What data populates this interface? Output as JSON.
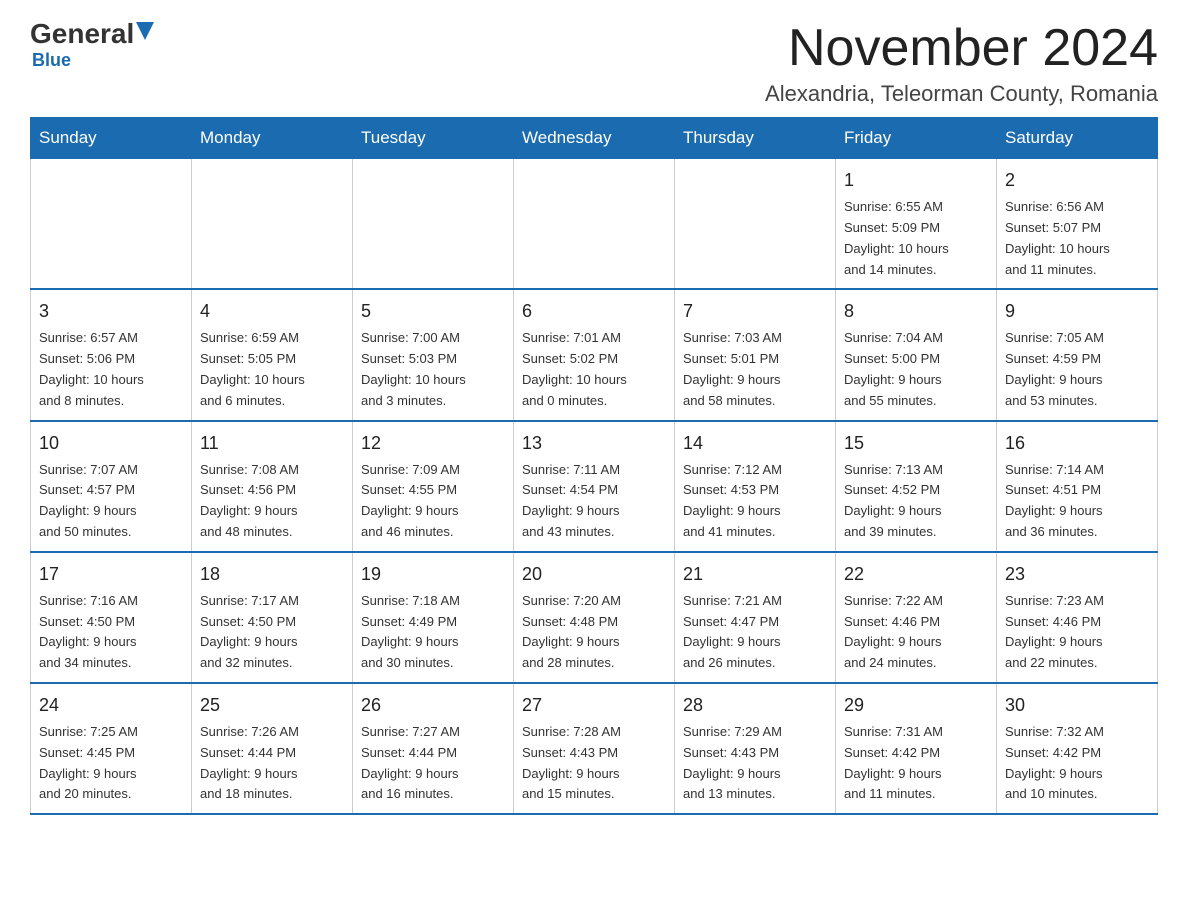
{
  "logo": {
    "general": "General",
    "triangle_symbol": "▶",
    "blue": "Blue"
  },
  "header": {
    "month": "November 2024",
    "location": "Alexandria, Teleorman County, Romania"
  },
  "days_of_week": [
    "Sunday",
    "Monday",
    "Tuesday",
    "Wednesday",
    "Thursday",
    "Friday",
    "Saturday"
  ],
  "weeks": [
    [
      {
        "day": "",
        "info": ""
      },
      {
        "day": "",
        "info": ""
      },
      {
        "day": "",
        "info": ""
      },
      {
        "day": "",
        "info": ""
      },
      {
        "day": "",
        "info": ""
      },
      {
        "day": "1",
        "info": "Sunrise: 6:55 AM\nSunset: 5:09 PM\nDaylight: 10 hours\nand 14 minutes."
      },
      {
        "day": "2",
        "info": "Sunrise: 6:56 AM\nSunset: 5:07 PM\nDaylight: 10 hours\nand 11 minutes."
      }
    ],
    [
      {
        "day": "3",
        "info": "Sunrise: 6:57 AM\nSunset: 5:06 PM\nDaylight: 10 hours\nand 8 minutes."
      },
      {
        "day": "4",
        "info": "Sunrise: 6:59 AM\nSunset: 5:05 PM\nDaylight: 10 hours\nand 6 minutes."
      },
      {
        "day": "5",
        "info": "Sunrise: 7:00 AM\nSunset: 5:03 PM\nDaylight: 10 hours\nand 3 minutes."
      },
      {
        "day": "6",
        "info": "Sunrise: 7:01 AM\nSunset: 5:02 PM\nDaylight: 10 hours\nand 0 minutes."
      },
      {
        "day": "7",
        "info": "Sunrise: 7:03 AM\nSunset: 5:01 PM\nDaylight: 9 hours\nand 58 minutes."
      },
      {
        "day": "8",
        "info": "Sunrise: 7:04 AM\nSunset: 5:00 PM\nDaylight: 9 hours\nand 55 minutes."
      },
      {
        "day": "9",
        "info": "Sunrise: 7:05 AM\nSunset: 4:59 PM\nDaylight: 9 hours\nand 53 minutes."
      }
    ],
    [
      {
        "day": "10",
        "info": "Sunrise: 7:07 AM\nSunset: 4:57 PM\nDaylight: 9 hours\nand 50 minutes."
      },
      {
        "day": "11",
        "info": "Sunrise: 7:08 AM\nSunset: 4:56 PM\nDaylight: 9 hours\nand 48 minutes."
      },
      {
        "day": "12",
        "info": "Sunrise: 7:09 AM\nSunset: 4:55 PM\nDaylight: 9 hours\nand 46 minutes."
      },
      {
        "day": "13",
        "info": "Sunrise: 7:11 AM\nSunset: 4:54 PM\nDaylight: 9 hours\nand 43 minutes."
      },
      {
        "day": "14",
        "info": "Sunrise: 7:12 AM\nSunset: 4:53 PM\nDaylight: 9 hours\nand 41 minutes."
      },
      {
        "day": "15",
        "info": "Sunrise: 7:13 AM\nSunset: 4:52 PM\nDaylight: 9 hours\nand 39 minutes."
      },
      {
        "day": "16",
        "info": "Sunrise: 7:14 AM\nSunset: 4:51 PM\nDaylight: 9 hours\nand 36 minutes."
      }
    ],
    [
      {
        "day": "17",
        "info": "Sunrise: 7:16 AM\nSunset: 4:50 PM\nDaylight: 9 hours\nand 34 minutes."
      },
      {
        "day": "18",
        "info": "Sunrise: 7:17 AM\nSunset: 4:50 PM\nDaylight: 9 hours\nand 32 minutes."
      },
      {
        "day": "19",
        "info": "Sunrise: 7:18 AM\nSunset: 4:49 PM\nDaylight: 9 hours\nand 30 minutes."
      },
      {
        "day": "20",
        "info": "Sunrise: 7:20 AM\nSunset: 4:48 PM\nDaylight: 9 hours\nand 28 minutes."
      },
      {
        "day": "21",
        "info": "Sunrise: 7:21 AM\nSunset: 4:47 PM\nDaylight: 9 hours\nand 26 minutes."
      },
      {
        "day": "22",
        "info": "Sunrise: 7:22 AM\nSunset: 4:46 PM\nDaylight: 9 hours\nand 24 minutes."
      },
      {
        "day": "23",
        "info": "Sunrise: 7:23 AM\nSunset: 4:46 PM\nDaylight: 9 hours\nand 22 minutes."
      }
    ],
    [
      {
        "day": "24",
        "info": "Sunrise: 7:25 AM\nSunset: 4:45 PM\nDaylight: 9 hours\nand 20 minutes."
      },
      {
        "day": "25",
        "info": "Sunrise: 7:26 AM\nSunset: 4:44 PM\nDaylight: 9 hours\nand 18 minutes."
      },
      {
        "day": "26",
        "info": "Sunrise: 7:27 AM\nSunset: 4:44 PM\nDaylight: 9 hours\nand 16 minutes."
      },
      {
        "day": "27",
        "info": "Sunrise: 7:28 AM\nSunset: 4:43 PM\nDaylight: 9 hours\nand 15 minutes."
      },
      {
        "day": "28",
        "info": "Sunrise: 7:29 AM\nSunset: 4:43 PM\nDaylight: 9 hours\nand 13 minutes."
      },
      {
        "day": "29",
        "info": "Sunrise: 7:31 AM\nSunset: 4:42 PM\nDaylight: 9 hours\nand 11 minutes."
      },
      {
        "day": "30",
        "info": "Sunrise: 7:32 AM\nSunset: 4:42 PM\nDaylight: 9 hours\nand 10 minutes."
      }
    ]
  ]
}
